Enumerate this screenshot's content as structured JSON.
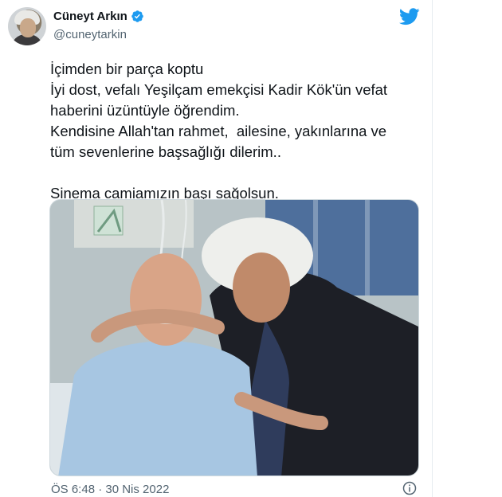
{
  "tweet": {
    "author": {
      "display_name": "Cüneyt Arkın",
      "handle": "@cuneytarkin",
      "verified_icon": "verified-badge-icon",
      "avatar": "avatar"
    },
    "brand_icon": "twitter-bird-icon",
    "text_lines": [
      "İçimden bir parça koptu",
      "İyi dost, vefalı Yeşilçam emekçisi Kadir Kök'ün vefat",
      "haberini üzüntüyle öğrendim.",
      "Kendisine Allah'tan rahmet,  ailesine, yakınlarına ve",
      "tüm sevenlerine başsağlığı dilerim..",
      "",
      "Sinema camiamızın başı sağolsun."
    ],
    "timestamp": "ÖS 6:48 · 30 Nis 2022",
    "info_icon": "info-icon",
    "colors": {
      "brand_blue": "#1d9bf0",
      "text": "#0f1419",
      "muted": "#536471"
    }
  }
}
